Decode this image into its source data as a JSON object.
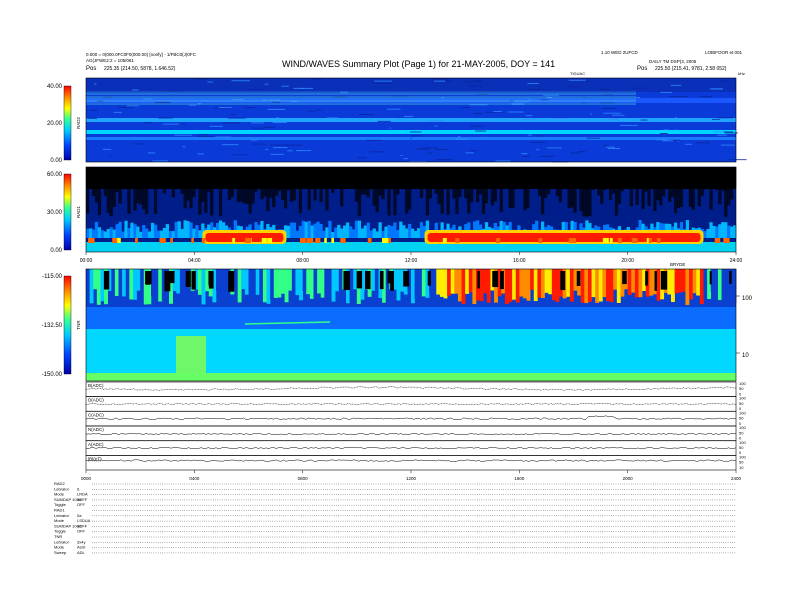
{
  "header": {
    "title": "WIND/WAVES Summary Plot (Page 1) for 21-MAY-2005, DOY = 141",
    "top_left_line1": "0.000 = 0(000.0FC0F0(000.00) [nonfy] - 1/FBC0(J)0FC",
    "top_left_line2": "AG(JFWE2:2 = 105/061",
    "top_left_pos_label": "Pos",
    "top_left_pos_value": "225.35 (214.50, 5878, 1.646.52)",
    "top_center_right": "1.10 WED 2UFCD",
    "top_right": "LOBIFOOR et 001",
    "right_line2": "DAILY TM DSP(3, 2005",
    "right_pos_label": "Pos",
    "right_pos_value": "225.50 (215.41, 9781, 2.58 052)",
    "ut_label_center": "TIGUAC",
    "ut_label_right": "kHz"
  },
  "chart_data": [
    {
      "type": "heatmap",
      "panel": "RAD2",
      "ylabel": "RAD2",
      "ytick_labels": [
        "40.00",
        "20.00",
        "0.00"
      ],
      "colormap": [
        "#000000",
        "#0000aa",
        "#0033ff",
        "#00aaff",
        "#00ffff",
        "#77ff55",
        "#ffff00",
        "#ff8800",
        "#ff0000"
      ]
    },
    {
      "type": "heatmap",
      "panel": "RAD1",
      "ylabel": "RAD1",
      "ytick_labels": [
        "60.00",
        "30.00",
        "0.00"
      ],
      "xtick_labels": [
        "00:00",
        "04:00",
        "08:00",
        "12:00",
        "16:00",
        "20:00",
        "24:00"
      ],
      "x_range_hours": [
        0,
        24
      ],
      "high_emission_hours": [
        [
          4.3,
          7.4
        ],
        [
          12.5,
          22.8
        ]
      ]
    },
    {
      "type": "heatmap",
      "panel": "TNR",
      "ylabel": "TNR",
      "ytick_labels": [
        "-115.00",
        "-132.50",
        "-150.00"
      ],
      "right_tick_labels": [
        "100",
        "10"
      ],
      "top_right_label": "BRYDE"
    },
    {
      "type": "line",
      "panels": [
        {
          "label": "B(ADC)",
          "right_ticks": [
            "100",
            "50",
            "0"
          ]
        },
        {
          "label": "D(ADC)",
          "right_ticks": [
            "100",
            "50",
            "0"
          ]
        },
        {
          "label": "C(ADC)",
          "right_ticks": [
            "100",
            "50",
            "0"
          ]
        },
        {
          "label": "N(ADC)",
          "right_ticks": [
            "100",
            "50",
            "0"
          ]
        },
        {
          "label": "A(ADC)",
          "right_ticks": [
            "100",
            "50",
            "0"
          ]
        },
        {
          "label": "|B|(nT)",
          "right_ticks": [
            "100",
            "50",
            "10"
          ]
        }
      ],
      "xtick_labels": [
        "0000",
        "0400",
        "0800",
        "1200",
        "1600",
        "2000",
        "2400"
      ]
    }
  ],
  "footer": {
    "rows": [
      [
        "RAD2",
        ""
      ],
      [
        "Lebrator",
        "0."
      ],
      [
        "Mode",
        "LRDA"
      ],
      [
        "SUMDAP 10Hz",
        "1OFF"
      ],
      [
        "Toggle",
        "OFF"
      ],
      [
        "RAD1",
        ""
      ],
      [
        "Lebrator",
        "0a"
      ],
      [
        "Mode",
        "LSDUA"
      ],
      [
        "SUMDAP 10Hz",
        "1OFF"
      ],
      [
        "Toggle",
        "OFF"
      ],
      [
        "TNR",
        ""
      ],
      [
        "Lebrator",
        "3x4y"
      ],
      [
        "Mode",
        "AUD"
      ],
      [
        "Sweep",
        "ADL"
      ]
    ]
  }
}
